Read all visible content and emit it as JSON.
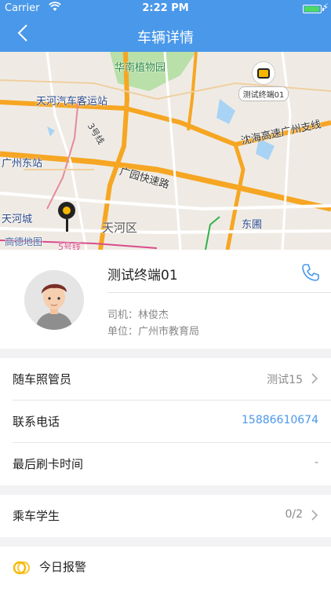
{
  "status_bar": {
    "carrier": "Carrier",
    "time": "2:22 PM",
    "battery_level": 0.95
  },
  "nav": {
    "title": "车辆详情",
    "back_icon": "chevron-left-icon"
  },
  "map": {
    "labels": {
      "botanical_garden": "华南植物园",
      "bus_station": "天河汽车客运站",
      "line3": "3号线",
      "guangzhou_east": "广州东站",
      "shenhai_expressway": "沈海高速广州支线",
      "guangyuan_expressway": "广园快速路",
      "tianhe_city": "天河城",
      "tianhe_district": "天河区",
      "donghu": "东圃",
      "line5": "5号线",
      "amap_logo": "高德地图"
    },
    "bus_marker_label": "测试终端01",
    "colors": {
      "expressway": "#f6a623",
      "water": "#a9d3f5",
      "park": "#b8e0a8",
      "background": "#ede9e2"
    }
  },
  "vehicle": {
    "name": "测试终端01",
    "driver": "司机：林俊杰",
    "unit": "单位：广州市教育局"
  },
  "rows": {
    "escort": {
      "label": "随车照管员",
      "value": "测试15"
    },
    "phone": {
      "label": "联系电话",
      "value": "15886610674"
    },
    "last_swipe": {
      "label": "最后刷卡时间",
      "value": "-"
    },
    "students": {
      "label": "乘车学生",
      "value": "0/2"
    }
  },
  "alarm": {
    "label": "今日报警"
  },
  "colors": {
    "accent": "#4a98e9",
    "battery": "#4cd964",
    "bus": "#f5b700"
  }
}
